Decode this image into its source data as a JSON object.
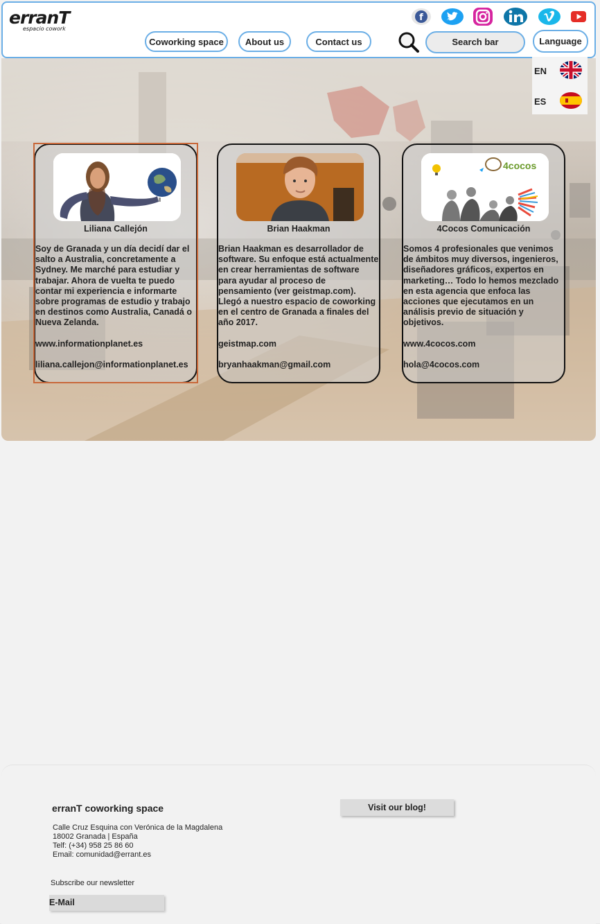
{
  "header": {
    "logo_main": "erranT",
    "logo_sub": "espacio cowork",
    "social_icons": [
      "facebook-icon",
      "twitter-icon",
      "instagram-icon",
      "linkedin-icon",
      "vimeo-icon",
      "youtube-icon"
    ],
    "nav": {
      "coworking": "Coworking space",
      "about": "About us",
      "contact": "Contact us"
    },
    "search_label": "Search bar",
    "language_label": "Language",
    "languages": [
      {
        "code": "EN",
        "flag": "uk-flag-icon"
      },
      {
        "code": "ES",
        "flag": "spain-flag-icon"
      }
    ]
  },
  "members": [
    {
      "name": "Liliana Callejón",
      "description": "Soy de Granada y un día decidí dar el salto a Australia, concretamente a Sydney. Me marché para estudiar y trabajar. Ahora de vuelta te puedo contar mi experiencia e informarte sobre programas de estudio y trabajo en destinos como Australia, Canadá o Nueva Zelanda.",
      "website": "www.informationplanet.es",
      "email": "liliana.callejon@informationplanet.es"
    },
    {
      "name": "Brian Haakman",
      "description": "Brian Haakman es desarrollador de software. Su enfoque está actualmente en crear herramientas de software para ayudar al proceso de pensamiento (ver geistmap.com). Llegó a nuestro espacio de coworking en el centro de Granada a finales del año 2017.",
      "website": "geistmap.com",
      "email": "bryanhaakman@gmail.com"
    },
    {
      "name": "4Cocos Comunicación",
      "description": "Somos 4 profesionales que venimos de ámbitos muy diversos, ingenieros, diseñadores gráficos, expertos en marketing… Todo lo hemos mezclado en esta agencia que enfoca las acciones que ejecutamos en un análisis previo de situación y objetivos.",
      "website": "www.4cocos.com",
      "email": "hola@4cocos.com",
      "logo_text": "4cocos"
    }
  ],
  "footer": {
    "title": "erranT coworking space",
    "address_line1": "Calle Cruz Esquina con Verónica de la Magdalena",
    "address_line2": "18002 Granada | España",
    "phone": "Telf: (+34) 958 25 86 60",
    "email": "Email: comunidad@errant.es",
    "blog_button": "Visit our blog!",
    "newsletter_label": "Subscribe our newsletter",
    "email_field": "E-Mail"
  },
  "colors": {
    "accent_border": "#6aaee6",
    "selection_outline": "#c8683a",
    "facebook": "#3b5998",
    "twitter": "#1da1f2",
    "instagram": "#c13584",
    "linkedin": "#0e76a8",
    "vimeo": "#1ab7ea",
    "youtube": "#e52d27"
  }
}
